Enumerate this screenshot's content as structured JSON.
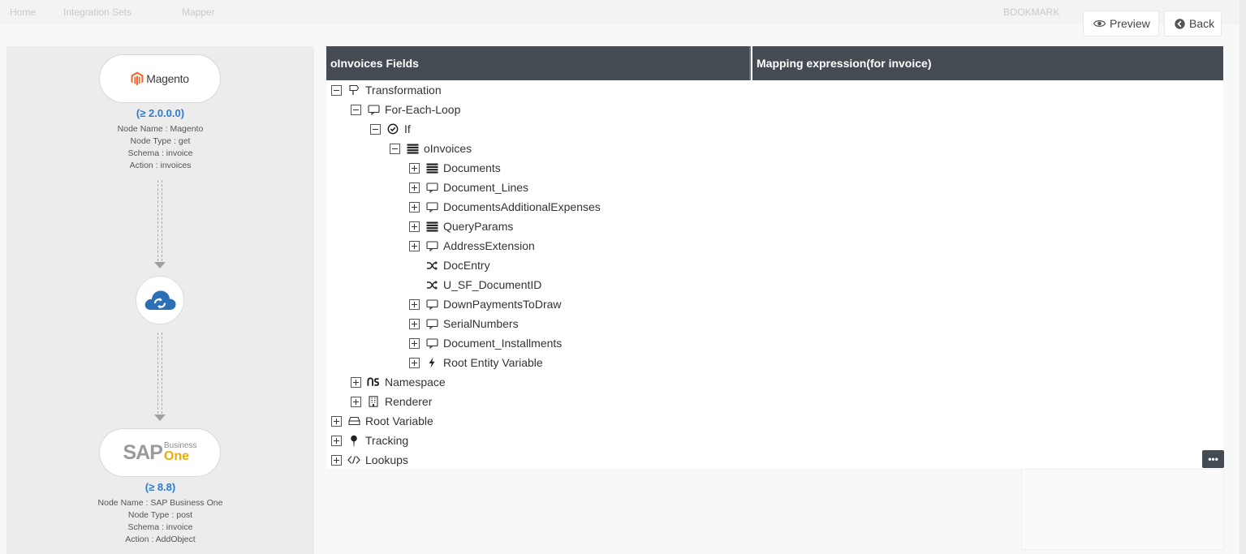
{
  "background": {
    "breadcrumb": [
      "Home",
      "Integration Sets",
      "Mapper"
    ],
    "right_label": "BOOKMARK"
  },
  "actions": {
    "preview_label": "Preview",
    "back_label": "Back"
  },
  "flow": {
    "source": {
      "logo_text": "Magento",
      "version": "(≥ 2.0.0.0)",
      "node_name": "Node Name : Magento",
      "node_type": "Node Type : get",
      "schema": "Schema : invoice",
      "action": "Action : invoices"
    },
    "target": {
      "logo_main": "SAP",
      "logo_business": "Business",
      "logo_one": "One",
      "version": "(≥ 8.8)",
      "node_name": "Node Name : SAP Business One",
      "node_type": "Node Type : post",
      "schema": "Schema : invoice",
      "action": "Action : AddObject"
    }
  },
  "mapper": {
    "col_fields": "oInvoices Fields",
    "col_mapping": "Mapping expression(for invoice)",
    "more_label": "•••",
    "tree": [
      {
        "label": "Transformation",
        "level": 0,
        "toggle": "minus",
        "icon": "transformation-icon"
      },
      {
        "label": "For-Each-Loop",
        "level": 1,
        "toggle": "minus",
        "icon": "loop-icon"
      },
      {
        "label": "If",
        "level": 2,
        "toggle": "minus",
        "icon": "check-circle-icon"
      },
      {
        "label": "oInvoices",
        "level": 3,
        "toggle": "minus",
        "icon": "list-icon"
      },
      {
        "label": "Documents",
        "level": 4,
        "toggle": "plus",
        "icon": "list-icon"
      },
      {
        "label": "Document_Lines",
        "level": 4,
        "toggle": "plus",
        "icon": "loop-icon"
      },
      {
        "label": "DocumentsAdditionalExpenses",
        "level": 4,
        "toggle": "plus",
        "icon": "loop-icon"
      },
      {
        "label": "QueryParams",
        "level": 4,
        "toggle": "plus",
        "icon": "list-icon"
      },
      {
        "label": "AddressExtension",
        "level": 4,
        "toggle": "plus",
        "icon": "loop-icon"
      },
      {
        "label": "DocEntry",
        "level": 4,
        "toggle": "none",
        "icon": "shuffle-icon"
      },
      {
        "label": "U_SF_DocumentID",
        "level": 4,
        "toggle": "none",
        "icon": "shuffle-icon"
      },
      {
        "label": "DownPaymentsToDraw",
        "level": 4,
        "toggle": "plus",
        "icon": "loop-icon"
      },
      {
        "label": "SerialNumbers",
        "level": 4,
        "toggle": "plus",
        "icon": "loop-icon"
      },
      {
        "label": "Document_Installments",
        "level": 4,
        "toggle": "plus",
        "icon": "loop-icon"
      },
      {
        "label": "Root Entity Variable",
        "level": 4,
        "toggle": "plus",
        "icon": "bolt-icon"
      },
      {
        "label": "Namespace",
        "level": 1,
        "toggle": "plus",
        "icon": "namespace-icon"
      },
      {
        "label": "Renderer",
        "level": 1,
        "toggle": "plus",
        "icon": "building-icon"
      },
      {
        "label": "Root Variable",
        "level": 0,
        "toggle": "plus",
        "icon": "drive-icon"
      },
      {
        "label": "Tracking",
        "level": 0,
        "toggle": "plus",
        "icon": "pin-icon"
      },
      {
        "label": "Lookups",
        "level": 0,
        "toggle": "plus",
        "icon": "code-icon"
      }
    ]
  },
  "colors": {
    "header_bg": "#454b52",
    "version_blue": "#2b7bd0",
    "magento_orange": "#ee672f",
    "sap_gold": "#f0ab00",
    "cloud_blue": "#2b6fb6"
  }
}
